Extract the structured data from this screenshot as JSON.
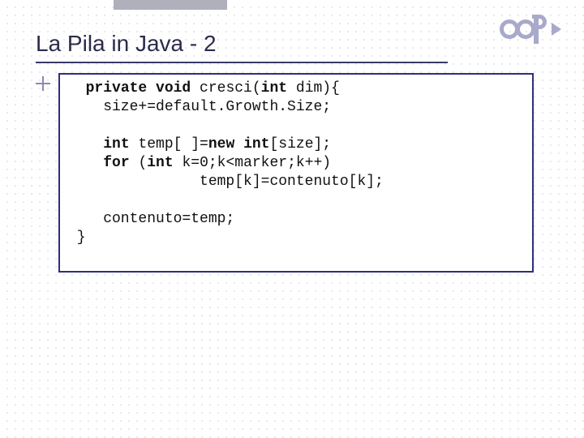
{
  "slide": {
    "title": "La Pila in Java - 2"
  },
  "code": {
    "l1a": "  ",
    "l1b": "private void ",
    "l1c": "cresci(",
    "l1d": "int ",
    "l1e": "dim){",
    "l2": "    size+=default.Growth.Size;",
    "l3": "",
    "l4a": "    ",
    "l4b": "int ",
    "l4c": "temp[ ]=",
    "l4d": "new int",
    "l4e": "[size];",
    "l5a": "    ",
    "l5b": "for ",
    "l5c": "(",
    "l5d": "int ",
    "l5e": "k=0;k<marker;k++)",
    "l6": "               temp[k]=contenuto[k];",
    "l7": "",
    "l8": "    contenuto=temp;",
    "l9": " }"
  }
}
